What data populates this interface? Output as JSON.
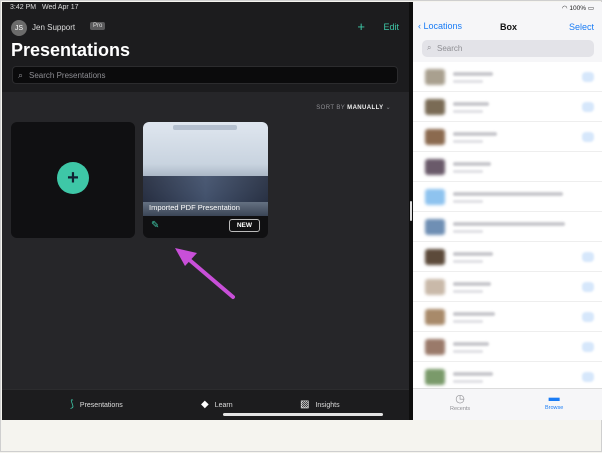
{
  "status_left": {
    "time": "3:42 PM",
    "date": "Wed Apr 17"
  },
  "header": {
    "avatar_initials": "JS",
    "user_name": "Jen Support",
    "badge": "Pro",
    "add_label": "+",
    "edit_label": "Edit"
  },
  "page_title": "Presentations",
  "search": {
    "placeholder": "Search Presentations",
    "icon": "search-icon"
  },
  "sort": {
    "prefix": "SORT BY",
    "value": "MANUALLY",
    "icon": "chevron-down-icon"
  },
  "add_card": {
    "label": "+"
  },
  "presentation": {
    "name": "Imported PDF Presentation",
    "badge": "NEW",
    "edit_icon": "pencil-icon"
  },
  "bottom_nav": [
    {
      "label": "Presentations",
      "icon": "presentations-icon"
    },
    {
      "label": "Learn",
      "icon": "learn-icon"
    },
    {
      "label": "Insights",
      "icon": "insights-icon"
    }
  ],
  "right_panel": {
    "battery": "100%",
    "back_label": "Locations",
    "title": "Box",
    "select_label": "Select",
    "search_placeholder": "Search",
    "tabs": [
      {
        "label": "Recents",
        "icon": "clock-icon"
      },
      {
        "label": "Browse",
        "icon": "folder-icon"
      }
    ]
  },
  "colors": {
    "accent": "#3ec7a7",
    "ios_blue": "#1a7cf5",
    "arrow": "#c84fd8",
    "bg_dark": "#1c1c1e"
  }
}
